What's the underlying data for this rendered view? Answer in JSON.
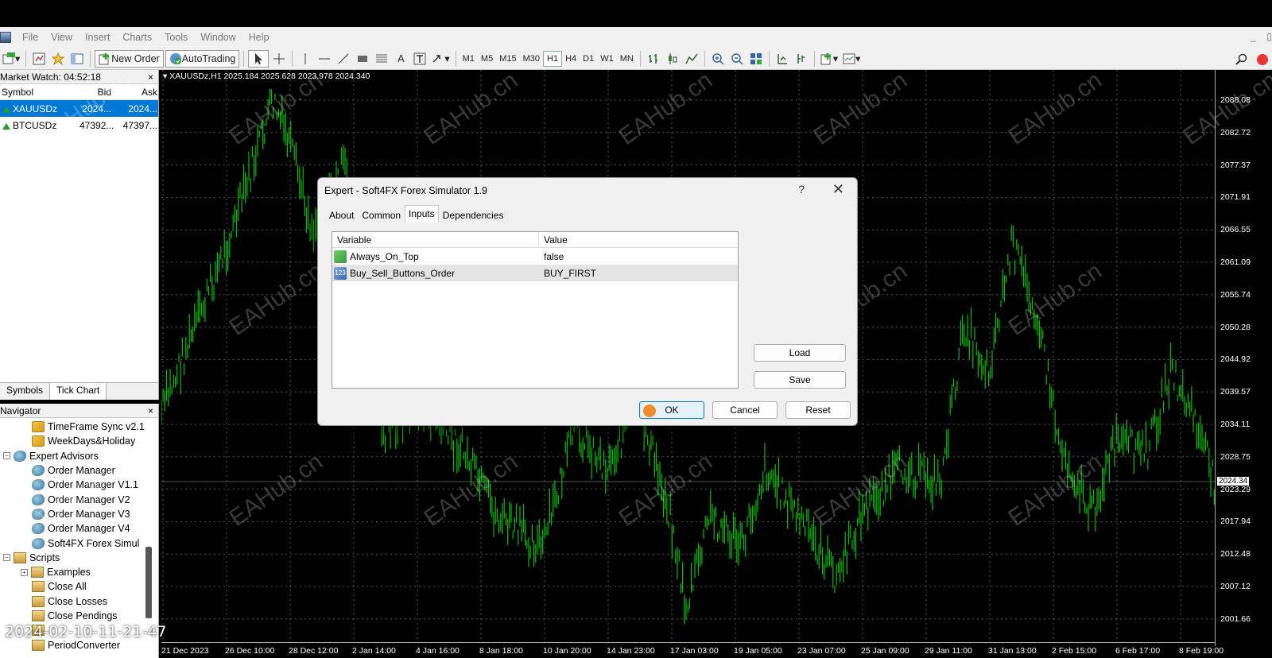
{
  "menu": {
    "items": [
      "File",
      "View",
      "Insert",
      "Charts",
      "Tools",
      "Window",
      "Help"
    ],
    "minimize": "_",
    "restore": "▯"
  },
  "toolbar": {
    "new_order_label": "New Order",
    "autotrading_label": "AutoTrading",
    "timeframes": [
      "M1",
      "M5",
      "M15",
      "M30",
      "H1",
      "H4",
      "D1",
      "W1",
      "MN"
    ],
    "active_timeframe": "H1",
    "text_tool": "A"
  },
  "market_watch": {
    "title": "Market Watch: 04:52:18",
    "close": "×",
    "columns": {
      "symbol": "Symbol",
      "bid": "Bid",
      "ask": "Ask"
    },
    "rows": [
      {
        "symbol": "XAUUSDz",
        "bid": "2024...",
        "ask": "2024..."
      },
      {
        "symbol": "BTCUSDz",
        "bid": "47392...",
        "ask": "47397..."
      }
    ],
    "tabs": [
      "Symbols",
      "Tick Chart"
    ]
  },
  "navigator": {
    "title": "Navigator",
    "close": "×",
    "items": [
      {
        "label": "TimeFrame Sync v2.1",
        "type": "indicator",
        "level": 2
      },
      {
        "label": "WeekDays&Holiday",
        "type": "indicator",
        "level": 2
      },
      {
        "label": "Expert Advisors",
        "type": "folder-ea",
        "level": 1,
        "toggle": "−"
      },
      {
        "label": "Order Manager",
        "type": "ea",
        "level": 2
      },
      {
        "label": "Order Manager V1.1",
        "type": "ea",
        "level": 2
      },
      {
        "label": "Order Manager V2",
        "type": "ea",
        "level": 2
      },
      {
        "label": "Order Manager V3",
        "type": "ea",
        "level": 2
      },
      {
        "label": "Order Manager V4",
        "type": "ea",
        "level": 2
      },
      {
        "label": "Soft4FX Forex Simul",
        "type": "ea",
        "level": 2
      },
      {
        "label": "Scripts",
        "type": "folder-script",
        "level": 1,
        "toggle": "−"
      },
      {
        "label": "Examples",
        "type": "script",
        "level": 2,
        "toggle": "+"
      },
      {
        "label": "Close All",
        "type": "script",
        "level": 2
      },
      {
        "label": "Close Losses",
        "type": "script",
        "level": 2
      },
      {
        "label": "Close Pendings",
        "type": "script",
        "level": 2
      },
      {
        "label": "",
        "type": "script",
        "level": 2
      },
      {
        "label": "PeriodConverter",
        "type": "script",
        "level": 2
      }
    ]
  },
  "chart": {
    "title": "XAUUSDz,H1  2025.184 2025.628 2023.978 2024.340",
    "current_price": "2024.34",
    "price_labels": [
      "2088.08",
      "2082.72",
      "2077.37",
      "2071.91",
      "2066.55",
      "2061.09",
      "2055.74",
      "2050.28",
      "2044.92",
      "2039.57",
      "2034.11",
      "2028.75",
      "2023.29",
      "2017.94",
      "2012.48",
      "2007.12",
      "2001.66"
    ],
    "time_labels": [
      "21 Dec 2023",
      "26 Dec 10:00",
      "28 Dec 12:00",
      "2 Jan 14:00",
      "4 Jan 16:00",
      "8 Jan 18:00",
      "10 Jan 20:00",
      "14 Jan 23:00",
      "17 Jan 03:00",
      "19 Jan 05:00",
      "23 Jan 07:00",
      "25 Jan 09:00",
      "29 Jan 11:00",
      "31 Jan 13:00",
      "2 Feb 15:00",
      "6 Feb 17:00",
      "8 Feb 19:00"
    ],
    "candle_color": "#00c000",
    "watermark": "EAHub.cn"
  },
  "dialog": {
    "title": "Expert - Soft4FX Forex Simulator 1.9",
    "help": "?",
    "close": "✕",
    "tabs": [
      "About",
      "Common",
      "Inputs",
      "Dependencies"
    ],
    "active_tab": "Inputs",
    "columns": {
      "variable": "Variable",
      "value": "Value"
    },
    "rows": [
      {
        "variable": "Always_On_Top",
        "value": "false",
        "icon": "bool"
      },
      {
        "variable": "Buy_Sell_Buttons_Order",
        "value": "BUY_FIRST",
        "icon": "enum",
        "icon_text": "123"
      }
    ],
    "buttons": {
      "load": "Load",
      "save": "Save",
      "ok": "OK",
      "cancel": "Cancel",
      "reset": "Reset"
    }
  },
  "overlay": {
    "timestamp": "2024-02-10-11-21-47"
  }
}
